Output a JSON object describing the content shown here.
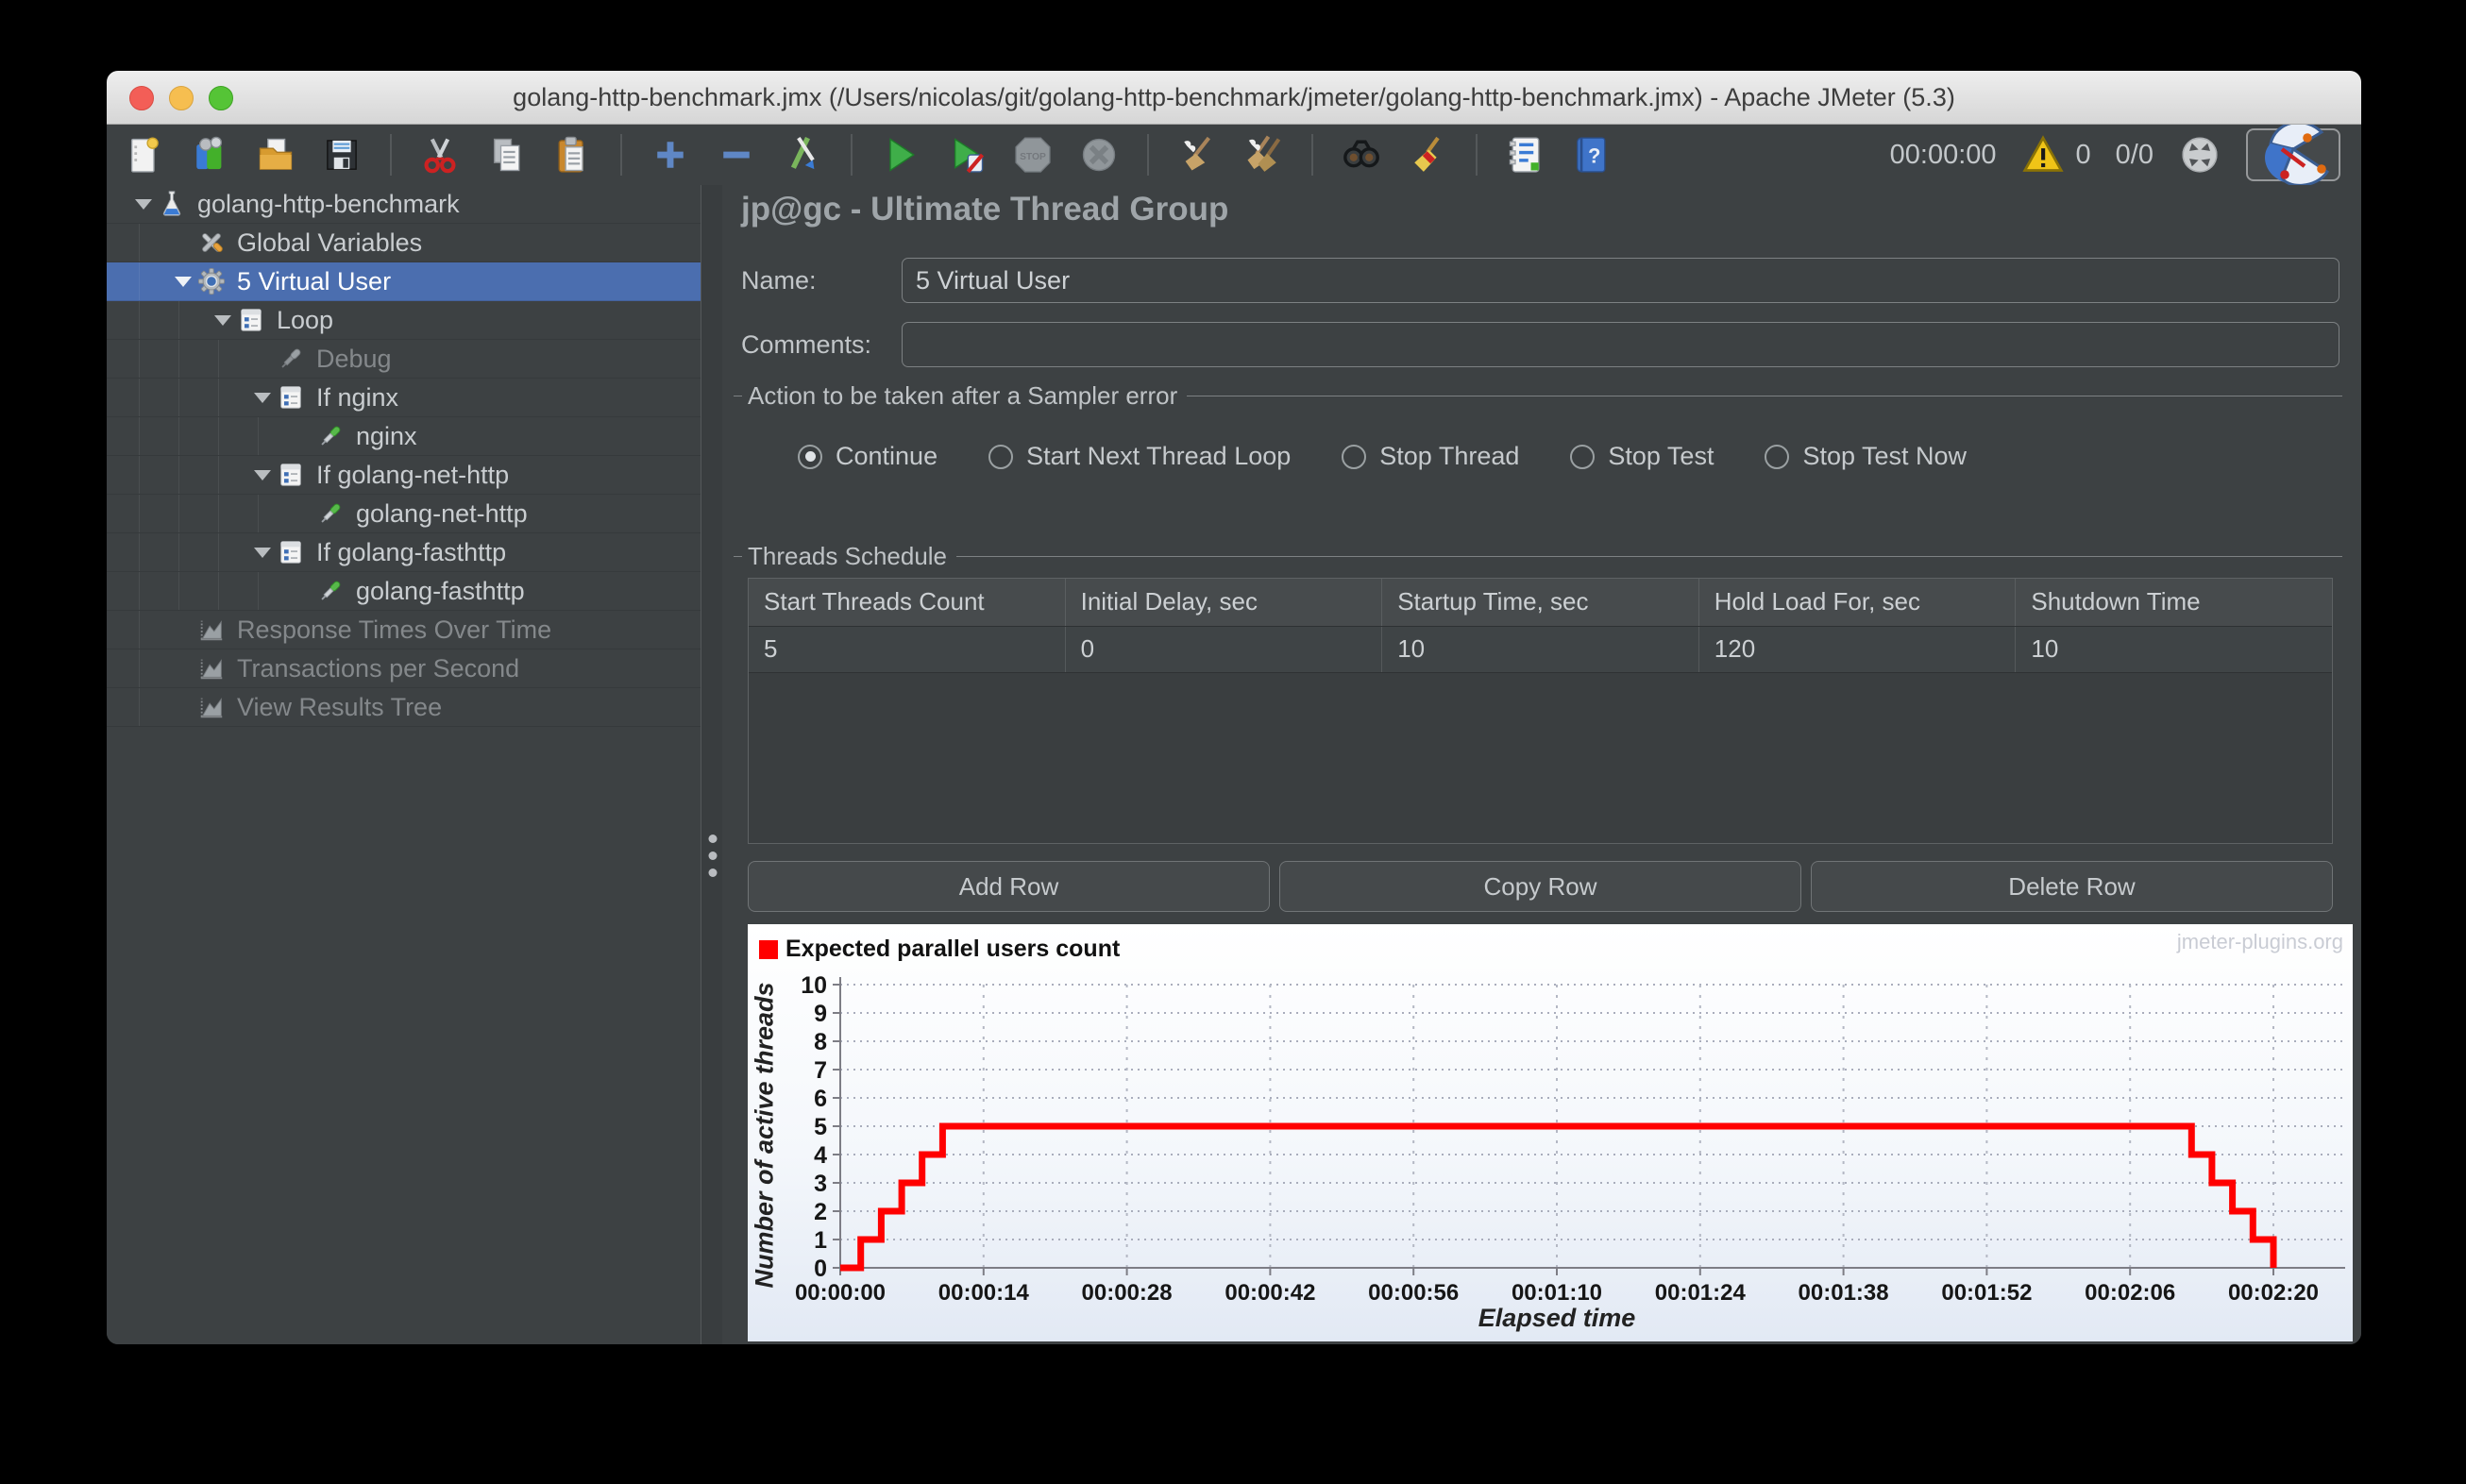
{
  "window": {
    "title": "golang-http-benchmark.jmx (/Users/nicolas/git/golang-http-benchmark/jmeter/golang-http-benchmark.jmx) - Apache JMeter (5.3)"
  },
  "toolbar": {
    "timer": "00:00:00",
    "warning_count": "0",
    "thread_count": "0/0",
    "items": [
      {
        "name": "new-file-icon"
      },
      {
        "name": "templates-icon"
      },
      {
        "name": "open-file-icon"
      },
      {
        "name": "save-icon"
      },
      {
        "name": "separator"
      },
      {
        "name": "cut-icon"
      },
      {
        "name": "copy-icon"
      },
      {
        "name": "paste-icon"
      },
      {
        "name": "separator"
      },
      {
        "name": "zoom-in-icon"
      },
      {
        "name": "zoom-out-icon"
      },
      {
        "name": "toggle-icon"
      },
      {
        "name": "separator"
      },
      {
        "name": "start-icon"
      },
      {
        "name": "start-no-timers-icon"
      },
      {
        "name": "stop-icon",
        "disabled": true
      },
      {
        "name": "shutdown-icon",
        "disabled": true
      },
      {
        "name": "separator"
      },
      {
        "name": "clear-icon"
      },
      {
        "name": "clear-all-icon"
      },
      {
        "name": "separator"
      },
      {
        "name": "search-icon"
      },
      {
        "name": "search-reset-icon"
      },
      {
        "name": "separator"
      },
      {
        "name": "function-helper-icon"
      },
      {
        "name": "help-icon"
      }
    ]
  },
  "tree": {
    "items": [
      {
        "label": "golang-http-benchmark",
        "level": 0,
        "icon": "test-plan-icon",
        "arrow": true
      },
      {
        "label": "Global Variables",
        "level": 1,
        "icon": "wrench-icon"
      },
      {
        "label": "5 Virtual User",
        "level": 1,
        "icon": "gear-icon",
        "arrow": true,
        "selected": true
      },
      {
        "label": "Loop",
        "level": 2,
        "icon": "controller-icon",
        "arrow": true
      },
      {
        "label": "Debug",
        "level": 3,
        "icon": "sampler-disabled-icon",
        "disabled": true
      },
      {
        "label": "If nginx",
        "level": 3,
        "icon": "controller-icon",
        "arrow": true
      },
      {
        "label": "nginx",
        "level": 4,
        "icon": "sampler-icon"
      },
      {
        "label": "If golang-net-http",
        "level": 3,
        "icon": "controller-icon",
        "arrow": true
      },
      {
        "label": "golang-net-http",
        "level": 4,
        "icon": "sampler-icon"
      },
      {
        "label": "If golang-fasthttp",
        "level": 3,
        "icon": "controller-icon",
        "arrow": true
      },
      {
        "label": "golang-fasthttp",
        "level": 4,
        "icon": "sampler-icon"
      },
      {
        "label": "Response Times Over Time",
        "level": 1,
        "icon": "chart-listener-icon",
        "disabled": true
      },
      {
        "label": "Transactions per Second",
        "level": 1,
        "icon": "chart-listener-icon",
        "disabled": true
      },
      {
        "label": "View Results Tree",
        "level": 1,
        "icon": "chart-listener-icon",
        "disabled": true
      }
    ]
  },
  "main": {
    "header": "jp@gc - Ultimate Thread Group",
    "name_label": "Name:",
    "name_value": "5 Virtual User",
    "comments_label": "Comments:",
    "comments_value": "",
    "action_group": {
      "title": "Action to be taken after a Sampler error",
      "options": [
        "Continue",
        "Start Next Thread Loop",
        "Stop Thread",
        "Stop Test",
        "Stop Test Now"
      ],
      "selected": "Continue"
    },
    "schedule": {
      "title": "Threads Schedule",
      "columns": [
        "Start Threads Count",
        "Initial Delay, sec",
        "Startup Time, sec",
        "Hold Load For, sec",
        "Shutdown Time"
      ],
      "rows": [
        [
          "5",
          "0",
          "10",
          "120",
          "10"
        ]
      ]
    },
    "buttons": [
      "Add Row",
      "Copy Row",
      "Delete Row"
    ]
  },
  "chart_data": {
    "type": "line",
    "legend": [
      "Expected parallel users count"
    ],
    "watermark": "jmeter-plugins.org",
    "xlabel": "Elapsed time",
    "ylabel": "Number of active threads",
    "ylim": [
      0,
      10
    ],
    "y_ticks": [
      0,
      1,
      2,
      3,
      4,
      5,
      6,
      7,
      8,
      9,
      10
    ],
    "x_ticks": [
      "00:00:00",
      "00:00:14",
      "00:00:28",
      "00:00:42",
      "00:00:56",
      "00:01:10",
      "00:01:24",
      "00:01:38",
      "00:01:52",
      "00:02:06",
      "00:02:20"
    ],
    "x_tick_seconds": [
      0,
      14,
      28,
      42,
      56,
      70,
      84,
      98,
      112,
      126,
      140
    ],
    "series": [
      {
        "name": "Expected parallel users count",
        "color": "#ff0000",
        "points": [
          [
            0,
            0
          ],
          [
            2,
            0
          ],
          [
            2,
            1
          ],
          [
            4,
            1
          ],
          [
            4,
            2
          ],
          [
            6,
            2
          ],
          [
            6,
            3
          ],
          [
            8,
            3
          ],
          [
            8,
            4
          ],
          [
            10,
            4
          ],
          [
            10,
            5
          ],
          [
            132,
            5
          ],
          [
            132,
            4
          ],
          [
            134,
            4
          ],
          [
            134,
            3
          ],
          [
            136,
            3
          ],
          [
            136,
            2
          ],
          [
            138,
            2
          ],
          [
            138,
            1
          ],
          [
            140,
            1
          ],
          [
            140,
            0
          ]
        ]
      }
    ]
  }
}
